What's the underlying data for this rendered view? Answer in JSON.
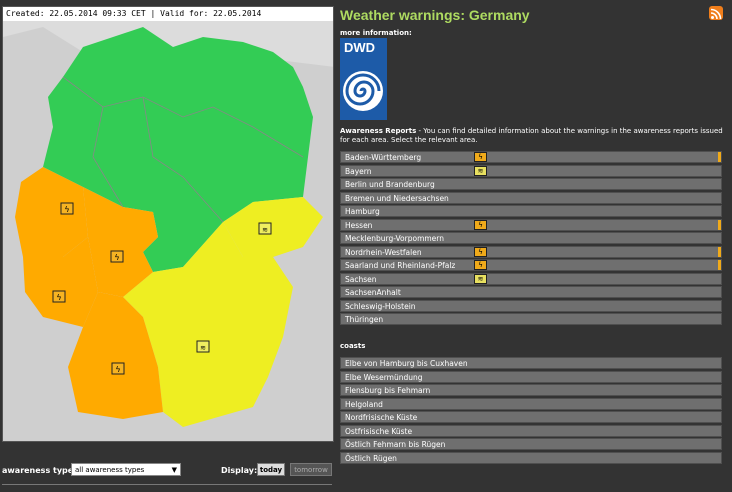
{
  "map": {
    "header": "Created: 22.05.2014 09:33 CET | Valid for: 22.05.2014",
    "colors": {
      "green": "#33cc55",
      "orange": "#ffaa00",
      "yellow": "#eeee22",
      "outside": "#c8c8c8",
      "sea": "#d8d8d8"
    }
  },
  "controls": {
    "awareness_label": "awareness types:",
    "awareness_value": "all awareness types",
    "display_label": "Display:",
    "today": "today",
    "tomorrow": "tomorrow"
  },
  "panel": {
    "title": "Weather warnings: Germany",
    "more_info": "more information:",
    "logo_text": "DWD",
    "awareness_title": "Awareness Reports",
    "awareness_text": " - You can find detailed information about the warnings in the awareness reports issued for each area. Select the relevant area."
  },
  "regions": [
    {
      "name": "Baden-Württemberg",
      "icon": "orange",
      "stripe": true
    },
    {
      "name": "Bayern",
      "icon": "yellow",
      "stripe": false
    },
    {
      "name": "Berlin und Brandenburg",
      "icon": "",
      "stripe": false
    },
    {
      "name": "Bremen und Niedersachsen",
      "icon": "",
      "stripe": false
    },
    {
      "name": "Hamburg",
      "icon": "",
      "stripe": false
    },
    {
      "name": "Hessen",
      "icon": "orange",
      "stripe": true
    },
    {
      "name": "Mecklenburg-Vorpommern",
      "icon": "",
      "stripe": false
    },
    {
      "name": "Nordrhein-Westfalen",
      "icon": "orange",
      "stripe": true
    },
    {
      "name": "Saarland und Rheinland-Pfalz",
      "icon": "orange",
      "stripe": true
    },
    {
      "name": "Sachsen",
      "icon": "yellow",
      "stripe": false
    },
    {
      "name": "SachsenAnhalt",
      "icon": "",
      "stripe": false
    },
    {
      "name": "Schleswig-Holstein",
      "icon": "",
      "stripe": false
    },
    {
      "name": "Thüringen",
      "icon": "",
      "stripe": false
    }
  ],
  "coasts_label": "coasts",
  "coasts": [
    "Elbe von Hamburg bis Cuxhaven",
    "Elbe Wesermündung",
    "Flensburg bis Fehmarn",
    "Helgoland",
    "Nordfrisische Küste",
    "Ostfrisische Küste",
    "Östlich Fehmarn bis Rügen",
    "Östlich Rügen"
  ]
}
